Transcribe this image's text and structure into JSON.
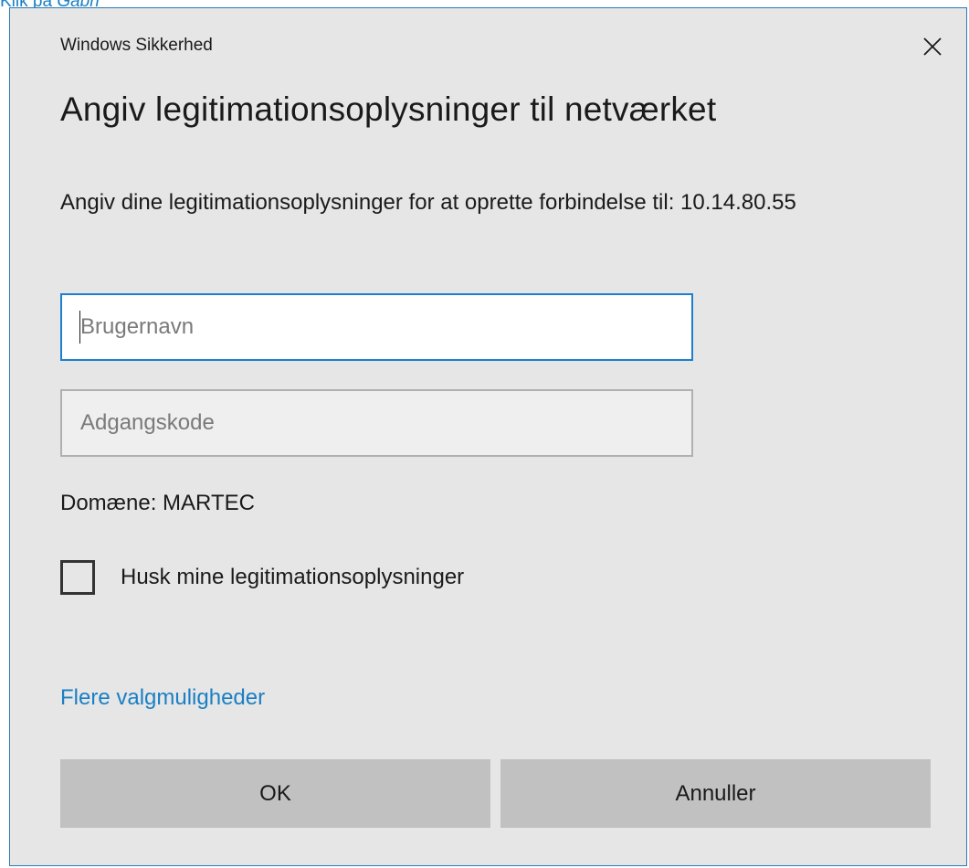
{
  "caption": {
    "prefix": "Klik på ",
    "emphasis": "Gabrl"
  },
  "dialog": {
    "window_title": "Windows Sikkerhed",
    "close_icon": "close-icon",
    "heading": "Angiv legitimationsoplysninger til netværket",
    "description": "Angiv dine legitimationsoplysninger for at oprette forbindelse til: 10.14.80.55",
    "username": {
      "value": "",
      "placeholder": "Brugernavn"
    },
    "password": {
      "value": "",
      "placeholder": "Adgangskode"
    },
    "domain_text": "Domæne: MARTEC",
    "remember": {
      "label": "Husk mine legitimationsoplysninger",
      "checked": false
    },
    "more_options": "Flere valgmuligheder",
    "ok_label": "OK",
    "cancel_label": "Annuller"
  },
  "colors": {
    "accent": "#1c7fd0",
    "link": "#1a7fc4",
    "dialog_bg": "#e6e6e6",
    "button_bg": "#c1c1c1"
  }
}
